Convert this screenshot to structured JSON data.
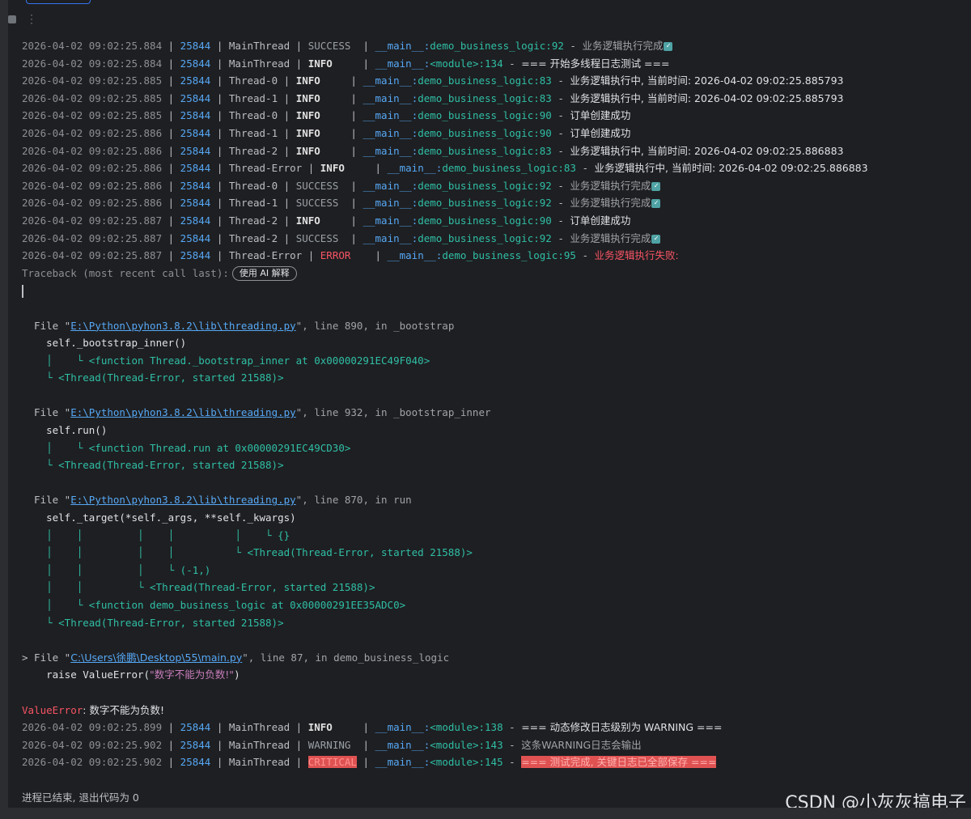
{
  "toolbar": {
    "stop_icon": "stop-icon",
    "more_icon": "more-icon",
    "more_glyph": "⋮"
  },
  "log_lines": [
    {
      "ts": "2026-04-02 09:02:25.884",
      "pid": "25844",
      "thread": "MainThread",
      "level": "SUCCESS",
      "lvl": "success",
      "mod": "__main__",
      "func": "demo_business_logic",
      "lineno": "92",
      "msg": "业务逻辑执行完成",
      "check": true,
      "msgcls": "msg-dim"
    },
    {
      "ts": "2026-04-02 09:02:25.884",
      "pid": "25844",
      "thread": "MainThread",
      "level": "INFO",
      "lvl": "info",
      "mod": "__main__",
      "func": "<module>",
      "lineno": "134",
      "msg": "=== 开始多线程日志测试 ===",
      "check": false,
      "msgcls": "msg"
    },
    {
      "ts": "2026-04-02 09:02:25.885",
      "pid": "25844",
      "thread": "Thread-0",
      "level": "INFO",
      "lvl": "info",
      "mod": "__main__",
      "func": "demo_business_logic",
      "lineno": "83",
      "msg": "业务逻辑执行中, 当前时间: 2026-04-02 09:02:25.885793",
      "check": false,
      "msgcls": "msg"
    },
    {
      "ts": "2026-04-02 09:02:25.885",
      "pid": "25844",
      "thread": "Thread-1",
      "level": "INFO",
      "lvl": "info",
      "mod": "__main__",
      "func": "demo_business_logic",
      "lineno": "83",
      "msg": "业务逻辑执行中, 当前时间: 2026-04-02 09:02:25.885793",
      "check": false,
      "msgcls": "msg"
    },
    {
      "ts": "2026-04-02 09:02:25.885",
      "pid": "25844",
      "thread": "Thread-0",
      "level": "INFO",
      "lvl": "info",
      "mod": "__main__",
      "func": "demo_business_logic",
      "lineno": "90",
      "msg": "订单创建成功",
      "check": false,
      "msgcls": "msg"
    },
    {
      "ts": "2026-04-02 09:02:25.886",
      "pid": "25844",
      "thread": "Thread-1",
      "level": "INFO",
      "lvl": "info",
      "mod": "__main__",
      "func": "demo_business_logic",
      "lineno": "90",
      "msg": "订单创建成功",
      "check": false,
      "msgcls": "msg"
    },
    {
      "ts": "2026-04-02 09:02:25.886",
      "pid": "25844",
      "thread": "Thread-2",
      "level": "INFO",
      "lvl": "info",
      "mod": "__main__",
      "func": "demo_business_logic",
      "lineno": "83",
      "msg": "业务逻辑执行中, 当前时间: 2026-04-02 09:02:25.886883",
      "check": false,
      "msgcls": "msg"
    },
    {
      "ts": "2026-04-02 09:02:25.886",
      "pid": "25844",
      "thread": "Thread-Error",
      "level": "INFO",
      "lvl": "info",
      "mod": "__main__",
      "func": "demo_business_logic",
      "lineno": "83",
      "msg": "业务逻辑执行中, 当前时间: 2026-04-02 09:02:25.886883",
      "check": false,
      "msgcls": "msg"
    },
    {
      "ts": "2026-04-02 09:02:25.886",
      "pid": "25844",
      "thread": "Thread-0",
      "level": "SUCCESS",
      "lvl": "success",
      "mod": "__main__",
      "func": "demo_business_logic",
      "lineno": "92",
      "msg": "业务逻辑执行完成",
      "check": true,
      "msgcls": "msg-dim"
    },
    {
      "ts": "2026-04-02 09:02:25.886",
      "pid": "25844",
      "thread": "Thread-1",
      "level": "SUCCESS",
      "lvl": "success",
      "mod": "__main__",
      "func": "demo_business_logic",
      "lineno": "92",
      "msg": "业务逻辑执行完成",
      "check": true,
      "msgcls": "msg-dim"
    },
    {
      "ts": "2026-04-02 09:02:25.887",
      "pid": "25844",
      "thread": "Thread-2",
      "level": "INFO",
      "lvl": "info",
      "mod": "__main__",
      "func": "demo_business_logic",
      "lineno": "90",
      "msg": "订单创建成功",
      "check": false,
      "msgcls": "msg"
    },
    {
      "ts": "2026-04-02 09:02:25.887",
      "pid": "25844",
      "thread": "Thread-2",
      "level": "SUCCESS",
      "lvl": "success",
      "mod": "__main__",
      "func": "demo_business_logic",
      "lineno": "92",
      "msg": "业务逻辑执行完成",
      "check": true,
      "msgcls": "msg-dim"
    },
    {
      "ts": "2026-04-02 09:02:25.887",
      "pid": "25844",
      "thread": "Thread-Error",
      "level": "ERROR",
      "lvl": "error",
      "mod": "__main__",
      "func": "demo_business_logic",
      "lineno": "95",
      "msg": "业务逻辑执行失败:",
      "check": false,
      "msgcls": "msg-err"
    }
  ],
  "traceback": {
    "header": "Traceback (most recent call last):",
    "ai_button": "使用 AI 解释",
    "frames": [
      {
        "prefix": "  File \"",
        "path": "E:\\Python\\pyhon3.8.2\\lib\\threading.py",
        "suffix": "\", line 890, in _bootstrap",
        "code": "    self._bootstrap_inner()",
        "tree": [
          "    │    └ <function Thread._bootstrap_inner at 0x00000291EC49F040>",
          "    └ <Thread(Thread-Error, started 21588)>"
        ]
      },
      {
        "prefix": "  File \"",
        "path": "E:\\Python\\pyhon3.8.2\\lib\\threading.py",
        "suffix": "\", line 932, in _bootstrap_inner",
        "code": "    self.run()",
        "tree": [
          "    │    └ <function Thread.run at 0x00000291EC49CD30>",
          "    └ <Thread(Thread-Error, started 21588)>"
        ]
      },
      {
        "prefix": "  File \"",
        "path": "E:\\Python\\pyhon3.8.2\\lib\\threading.py",
        "suffix": "\", line 870, in run",
        "code": "    self._target(*self._args, **self._kwargs)",
        "tree": [
          "    │    │         │    │          │    └ {}",
          "    │    │         │    │          └ <Thread(Thread-Error, started 21588)>",
          "    │    │         │    └ (-1,)",
          "    │    │         └ <Thread(Thread-Error, started 21588)>",
          "    │    └ <function demo_business_logic at 0x00000291EE35ADC0>",
          "    └ <Thread(Thread-Error, started 21588)>"
        ]
      }
    ],
    "last_frame": {
      "prefix": "> File \"",
      "path": "C:\\Users\\徐鹏\\Desktop\\55\\main.py",
      "suffix": "\", line 87, in demo_business_logic",
      "code_pre": "    raise ValueError(",
      "code_str": "\"数字不能为负数!\"",
      "code_post": ")"
    },
    "exc_name": "ValueError",
    "exc_msg": ": 数字不能为负数!"
  },
  "post_lines": [
    {
      "ts": "2026-04-02 09:02:25.899",
      "pid": "25844",
      "thread": "MainThread",
      "level": "INFO",
      "lvl": "info",
      "mod": "__main__",
      "func": "<module>",
      "lineno": "138",
      "msg": "=== 动态修改日志级别为 WARNING ===",
      "msgcls": "msg"
    },
    {
      "ts": "2026-04-02 09:02:25.902",
      "pid": "25844",
      "thread": "MainThread",
      "level": "WARNING",
      "lvl": "warning",
      "mod": "__main__",
      "func": "<module>",
      "lineno": "143",
      "msg": "这条WARNING日志会输出",
      "msgcls": "msg-dim"
    },
    {
      "ts": "2026-04-02 09:02:25.902",
      "pid": "25844",
      "thread": "MainThread",
      "level": "CRITICAL",
      "lvl": "critical",
      "mod": "__main__",
      "func": "<module>",
      "lineno": "145",
      "msg": "=== 测试完成, 关键日志已全部保存 ===",
      "msgcls": "msg-crit"
    }
  ],
  "exit_message": "进程已结束, 退出代码为 0",
  "watermark": "CSDN @小灰灰搞电子"
}
